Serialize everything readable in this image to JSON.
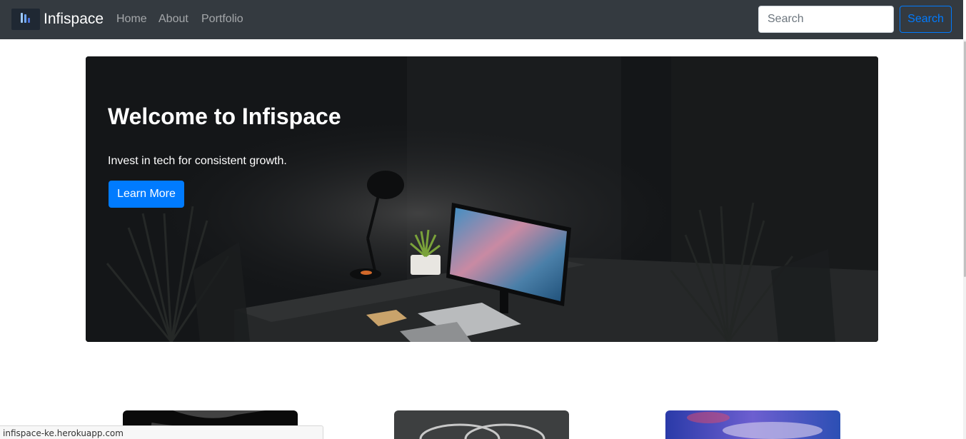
{
  "navbar": {
    "brand": "Infispace",
    "links": [
      "Home",
      "About",
      "Portfolio"
    ],
    "search_placeholder": "Search",
    "search_button": "Search",
    "background": "#343a40"
  },
  "hero": {
    "title": "Welcome to Infispace",
    "subtitle": "Invest in tech for consistent growth.",
    "button": "Learn More"
  },
  "cards": [
    {
      "name": "card-1-image"
    },
    {
      "name": "card-2-image"
    },
    {
      "name": "card-3-image"
    }
  ],
  "status_bar": {
    "url": "infispace-ke.herokuapp.com"
  },
  "colors": {
    "primary": "#007bff",
    "navbar": "#343a40"
  }
}
